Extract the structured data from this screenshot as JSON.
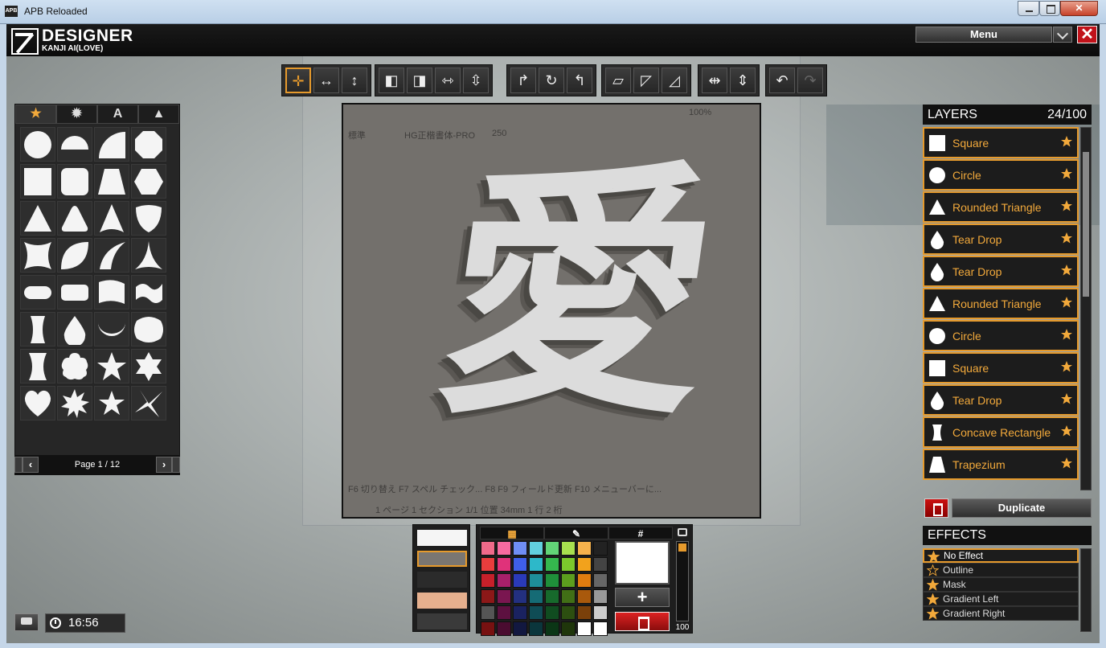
{
  "window": {
    "title": "APB Reloaded",
    "app_icon": "APB",
    "close_glyph": "✕"
  },
  "header": {
    "title": "DESIGNER",
    "subtitle": "KANJI AI(LOVE)",
    "menu_label": "Menu",
    "close_glyph": "✕"
  },
  "toolbar": {
    "groups": [
      [
        "move-icon",
        "stretch-horizontal-icon",
        "stretch-vertical-icon"
      ],
      [
        "align-top-left-icon",
        "align-top-right-icon",
        "fit-width-icon",
        "fit-height-icon"
      ],
      [
        "rotate-right-icon",
        "rotate-reset-icon",
        "rotate-left-icon"
      ],
      [
        "skew-icon",
        "skew-horizontal-icon",
        "skew-vertical-icon"
      ],
      [
        "flip-horizontal-icon",
        "flip-vertical-icon"
      ],
      [
        "undo-icon",
        "redo-icon"
      ]
    ]
  },
  "shapes": {
    "tabs": [
      "★",
      "✹",
      "A",
      "▲"
    ],
    "tab_names": [
      "favorites-tab",
      "shapes-tab",
      "text-tab",
      "symbols-tab"
    ],
    "items": [
      "circle",
      "half-circle",
      "quarter-circle",
      "octagon",
      "square",
      "rounded-square",
      "trapezium",
      "hexagon",
      "triangle",
      "rounded-triangle",
      "arrow-triangle",
      "shield",
      "concave-square",
      "leaf",
      "claw",
      "concave-triangle",
      "pill",
      "rounded-rectangle",
      "wave-flag",
      "wave-shape",
      "concave-rectangle",
      "tear-drop",
      "crescent",
      "lemon",
      "heart-thin",
      "flower",
      "star",
      "star-six",
      "heart",
      "burst",
      "star-small",
      "shuriken"
    ],
    "pager_label": "Page 1 / 12"
  },
  "canvas": {
    "symbol_char": "愛",
    "ghost_text": {
      "font_label": "HG正楷書体-PRO",
      "style_label": "標準",
      "size_label": "250",
      "zoom_label": "100%",
      "fn_keys": "F6 切り替え    F7 スペル チェック...   F8      F9 フィールド更新  F10 メニューバーに...",
      "status_line": "1 ページ    1 セクション    1/1    位置 34mm    1 行    2 桁"
    }
  },
  "palette": {
    "tabs": [
      "▦",
      "✎",
      "#"
    ],
    "swatches": [
      "#f06a8a",
      "#f76aa0",
      "#6f8ef5",
      "#62d0df",
      "#62d477",
      "#a8e04f",
      "#f6b24c",
      "#222222",
      "#e93d3d",
      "#e0327a",
      "#3f5fe8",
      "#2db8c9",
      "#35b84e",
      "#7cc92c",
      "#f2a21c",
      "#444444",
      "#c6202a",
      "#a8206a",
      "#2a3ab8",
      "#1e8e9a",
      "#1f8f3a",
      "#5c9e1e",
      "#e07d10",
      "#666666",
      "#8c1818",
      "#7a1650",
      "#233080",
      "#156b75",
      "#176a2c",
      "#416f16",
      "#a9590c",
      "#999999",
      "#555555",
      "#5d1040",
      "#1a2260",
      "#0f4c55",
      "#104c20",
      "#2c4e10",
      "#7a400a",
      "#cccccc",
      "#771111",
      "#4a0c30",
      "#121840",
      "#0b363c",
      "#0b3616",
      "#1f360b",
      "#ffffff",
      "#ffffff"
    ],
    "opacity_value": "100",
    "add_label": "+"
  },
  "layers": {
    "title": "LAYERS",
    "count": "24/100",
    "items": [
      {
        "name": "Square",
        "shape": "square"
      },
      {
        "name": "Circle",
        "shape": "circle"
      },
      {
        "name": "Rounded Triangle",
        "shape": "triangle"
      },
      {
        "name": "Tear Drop",
        "shape": "teardrop"
      },
      {
        "name": "Tear Drop",
        "shape": "teardrop"
      },
      {
        "name": "Rounded Triangle",
        "shape": "triangle"
      },
      {
        "name": "Circle",
        "shape": "circle"
      },
      {
        "name": "Square",
        "shape": "square"
      },
      {
        "name": "Tear Drop",
        "shape": "teardrop"
      },
      {
        "name": "Concave Rectangle",
        "shape": "concave"
      },
      {
        "name": "Trapezium",
        "shape": "trapezium"
      }
    ],
    "duplicate_label": "Duplicate"
  },
  "effects": {
    "title": "EFFECTS",
    "items": [
      "No Effect",
      "Outline",
      "Mask",
      "Gradient Left",
      "Gradient Right"
    ],
    "active": "No Effect"
  },
  "status": {
    "clock": "16:56"
  },
  "colors": {
    "accent": "#e69a2c",
    "panel": "#1c1c1c",
    "danger": "#c1121a"
  }
}
